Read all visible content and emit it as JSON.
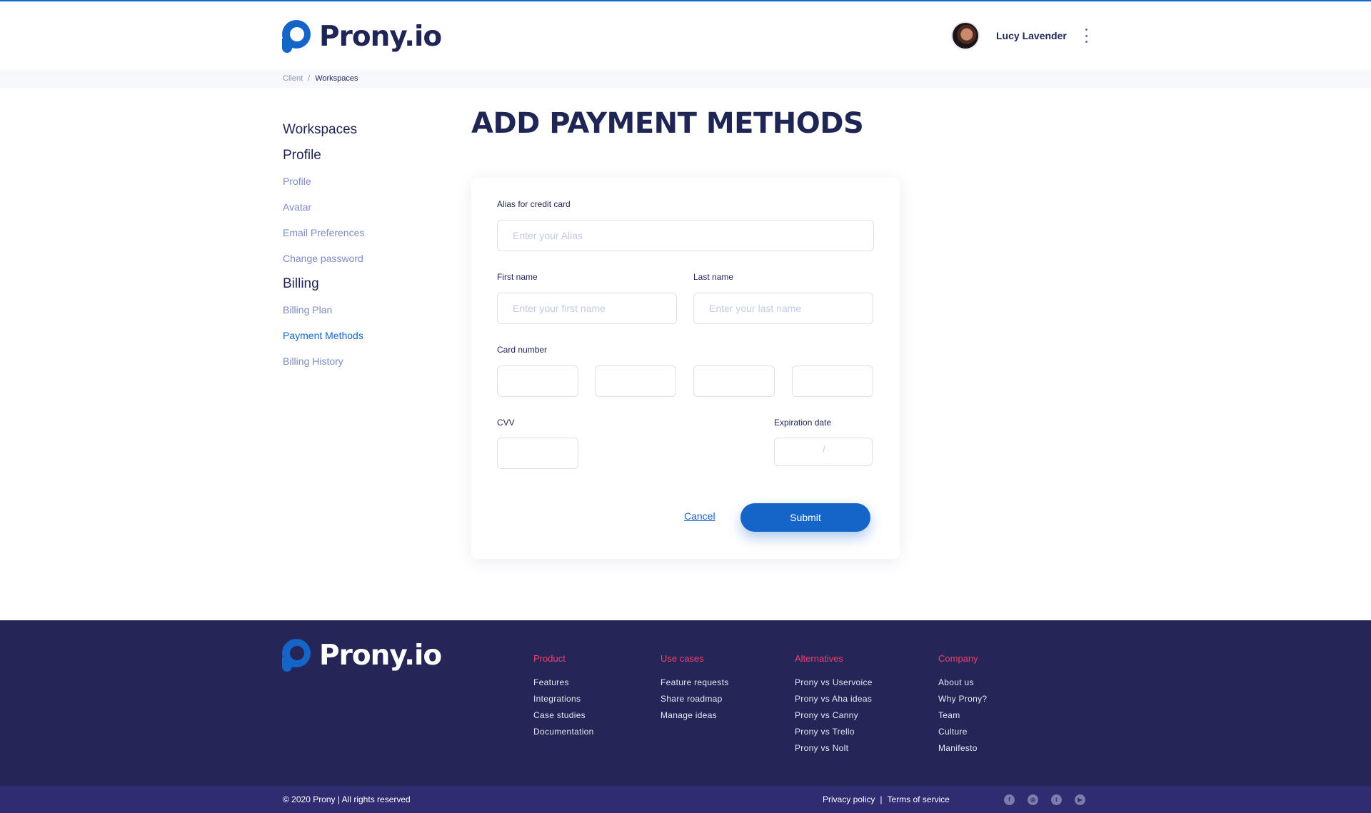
{
  "brand": {
    "name": "Prony.io"
  },
  "user": {
    "name": "Lucy Lavender"
  },
  "breadcrumb": {
    "items": [
      "Client",
      "Workspaces"
    ],
    "separator": "/"
  },
  "sidebar": {
    "workspaces": "Workspaces",
    "profile_section": "Profile",
    "profile_items": [
      "Profile",
      "Avatar",
      "Email Preferences",
      "Change password"
    ],
    "billing_section": "Billing",
    "billing_items": [
      "Billing Plan",
      "Payment Methods",
      "Billing History"
    ],
    "active_item": "Payment Methods"
  },
  "page": {
    "title": "ADD PAYMENT METHODS"
  },
  "form": {
    "alias_label": "Alias for credit card",
    "alias_placeholder": "Enter your Alias",
    "first_name_label": "First name",
    "first_name_placeholder": "Enter your first name",
    "last_name_label": "Last name",
    "last_name_placeholder": "Enter your last name",
    "card_number_label": "Card number",
    "cvv_label": "CVV",
    "expiration_label": "Expiration date",
    "expiration_separator": "/",
    "cancel_label": "Cancel",
    "submit_label": "Submit"
  },
  "footer": {
    "columns": [
      {
        "title": "Product",
        "links": [
          "Features",
          "Integrations",
          "Case studies",
          "Documentation"
        ]
      },
      {
        "title": "Use cases",
        "links": [
          "Feature requests",
          "Share roadmap",
          "Manage ideas"
        ]
      },
      {
        "title": "Alternatives",
        "links": [
          "Prony vs Uservoice",
          "Prony vs Aha ideas",
          "Prony vs Canny",
          "Prony vs Trello",
          "Prony vs Nolt"
        ]
      },
      {
        "title": "Company",
        "links": [
          "About us",
          "Why Prony?",
          "Team",
          "Culture",
          "Manifesto"
        ]
      }
    ],
    "copyright": "© 2020 Prony  |  All rights reserved",
    "privacy": "Privacy policy",
    "legal_separator": "|",
    "terms": "Terms of service",
    "socials": [
      "facebook-icon",
      "instagram-icon",
      "twitter-icon",
      "youtube-icon"
    ]
  },
  "colors": {
    "primary": "#1565c8",
    "navy": "#1f2554",
    "footer_bg": "#252558",
    "footer_bar": "#302c72",
    "accent": "#f0406b"
  }
}
